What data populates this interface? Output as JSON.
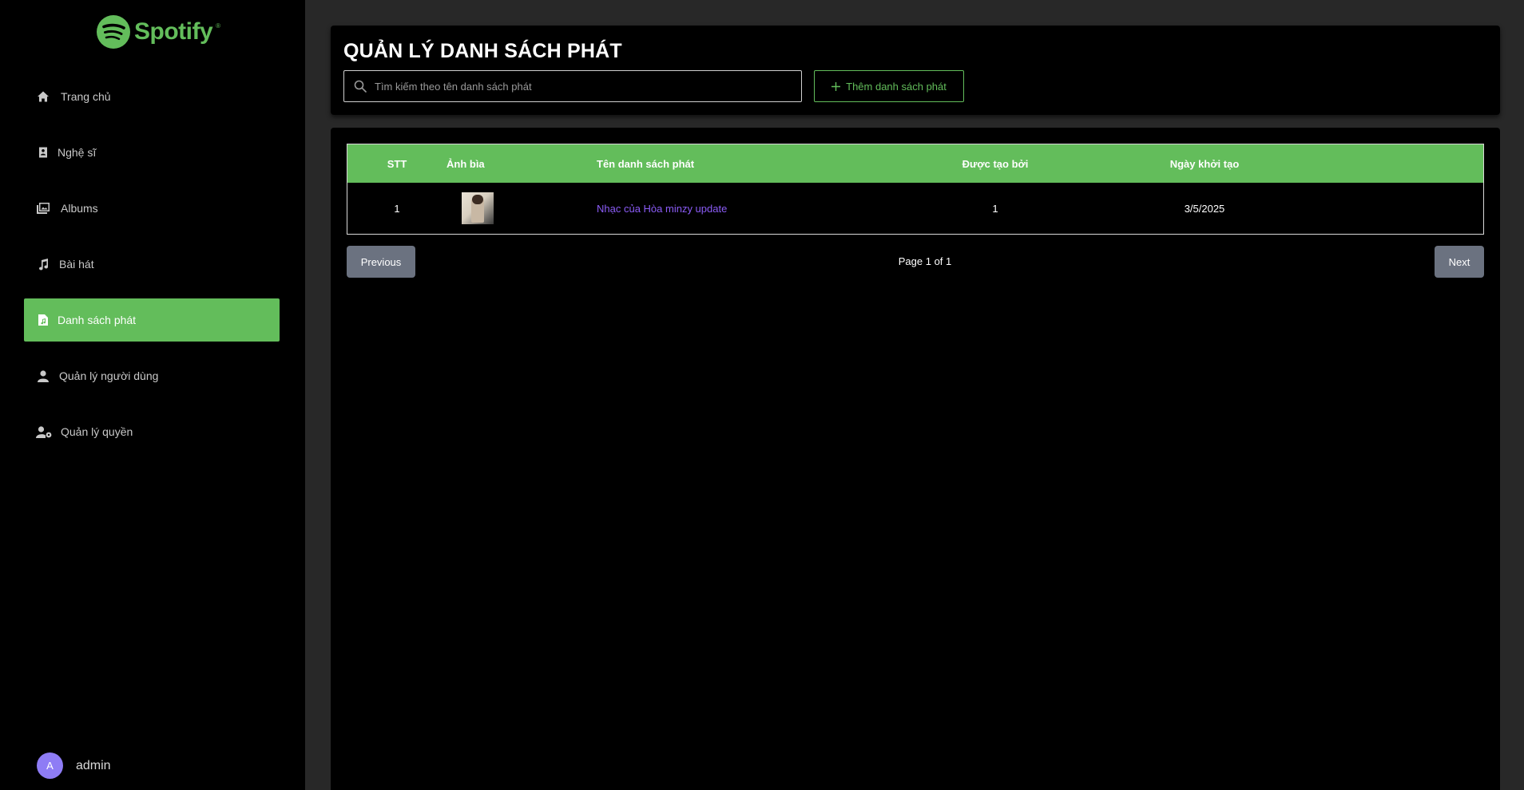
{
  "brand": {
    "name": "Spotify",
    "tm": "®",
    "color": "#63bd5b"
  },
  "sidebar": {
    "items": [
      {
        "label": "Trang chủ",
        "icon": "home-icon",
        "active": false
      },
      {
        "label": "Nghệ sĩ",
        "icon": "artist-icon",
        "active": false
      },
      {
        "label": "Albums",
        "icon": "album-icon",
        "active": false
      },
      {
        "label": "Bài hát",
        "icon": "music-note-icon",
        "active": false
      },
      {
        "label": "Danh sách phát",
        "icon": "playlist-icon",
        "active": true
      },
      {
        "label": "Quản lý người dùng",
        "icon": "user-icon",
        "active": false
      },
      {
        "label": "Quản lý quyền",
        "icon": "user-permission-icon",
        "active": false
      }
    ],
    "user": {
      "initial": "A",
      "name": "admin",
      "avatar_color": "#8e7cf5"
    }
  },
  "header": {
    "title": "QUẢN LÝ DANH SÁCH PHÁT",
    "search_placeholder": "Tìm kiếm theo tên danh sách phát",
    "add_label": "Thêm danh sách phát"
  },
  "table": {
    "columns": [
      "STT",
      "Ảnh bìa",
      "Tên danh sách phát",
      "Được tạo bởi",
      "Ngày khởi tạo"
    ],
    "rows": [
      {
        "stt": "1",
        "name": "Nhạc của Hòa minzy update",
        "created_by": "1",
        "created_at": "3/5/2025"
      }
    ]
  },
  "pagination": {
    "prev_label": "Previous",
    "info": "Page 1 of 1",
    "next_label": "Next"
  },
  "colors": {
    "accent": "#63bd5b",
    "link": "#8b5cf6",
    "button_gray": "#6b7280"
  }
}
